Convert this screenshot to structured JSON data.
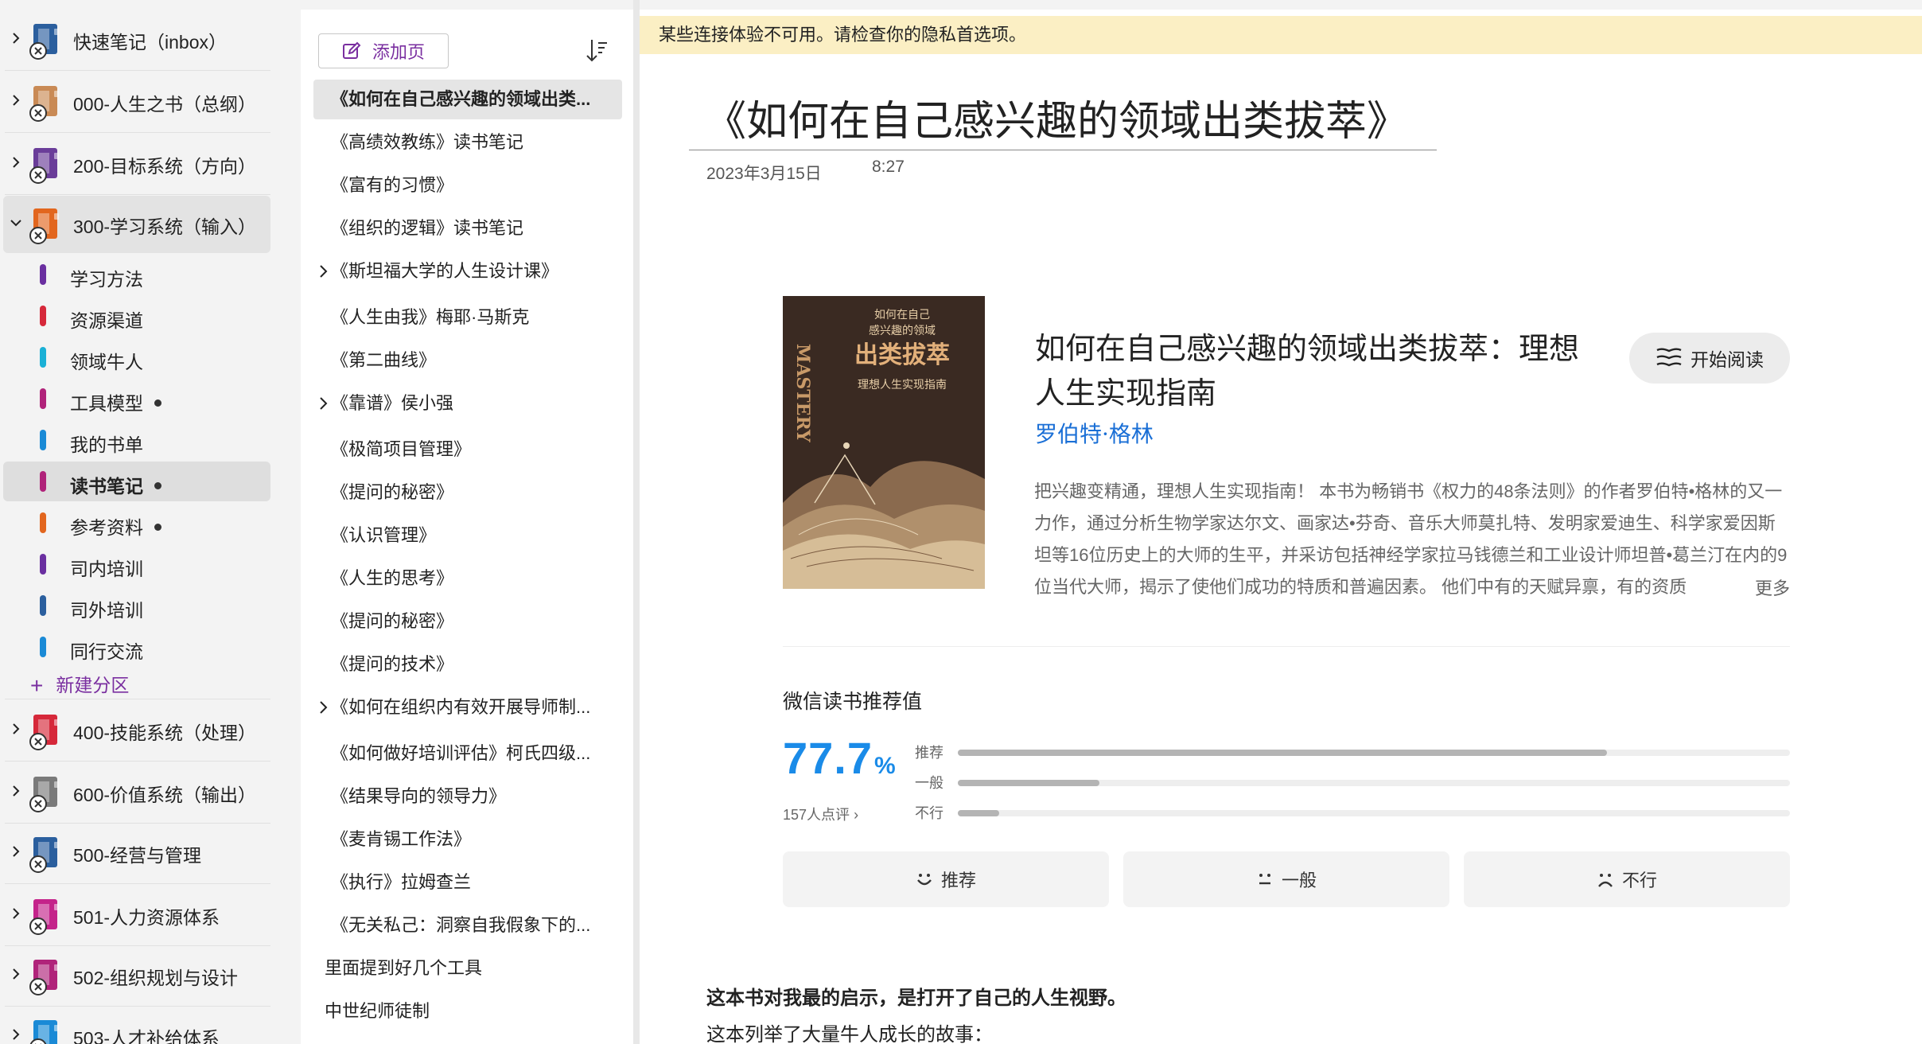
{
  "notebooks": [
    {
      "label": "快速笔记（inbox）",
      "color": "#2b5f9e",
      "expanded": false
    },
    {
      "label": "000-人生之书（总纲）",
      "color": "#c98a55",
      "expanded": false
    },
    {
      "label": "200-目标系统（方向）",
      "color": "#6a3d99",
      "expanded": false
    },
    {
      "label": "300-学习系统（输入）",
      "color": "#e2661e",
      "expanded": true
    },
    {
      "label": "400-技能系统（处理）",
      "color": "#d6283a",
      "expanded": false
    },
    {
      "label": "600-价值系统（输出）",
      "color": "#7a7a7a",
      "expanded": false
    },
    {
      "label": "500-经营与管理",
      "color": "#2b5f9e",
      "expanded": false
    },
    {
      "label": "501-人力资源体系",
      "color": "#c4238a",
      "expanded": false
    },
    {
      "label": "502-组织规划与设计",
      "color": "#b0237a",
      "expanded": false
    },
    {
      "label": "503-人才补给体系",
      "color": "#1a8ad6",
      "expanded": false
    }
  ],
  "sections": [
    {
      "label": "学习方法",
      "color": "#6a2fa0",
      "dot": false
    },
    {
      "label": "资源渠道",
      "color": "#d6283a",
      "dot": false
    },
    {
      "label": "领域牛人",
      "color": "#1ab0d6",
      "dot": false
    },
    {
      "label": "工具模型",
      "color": "#b0237a",
      "dot": true
    },
    {
      "label": "我的书单",
      "color": "#1a8ad6",
      "dot": false
    },
    {
      "label": "读书笔记",
      "color": "#b0237a",
      "dot": true
    },
    {
      "label": "参考资料",
      "color": "#e2661e",
      "dot": true
    },
    {
      "label": "司内培训",
      "color": "#6a2fa0",
      "dot": false
    },
    {
      "label": "司外培训",
      "color": "#2b5f9e",
      "dot": false
    },
    {
      "label": "同行交流",
      "color": "#1a8ad6",
      "dot": false
    }
  ],
  "new_section_label": "新建分区",
  "add_page_label": "添加页",
  "pages": [
    {
      "label": "《如何在自己感兴趣的领域出类...",
      "chev": false,
      "indent": false
    },
    {
      "label": "《高绩效教练》读书笔记",
      "chev": false,
      "indent": false
    },
    {
      "label": "《富有的习惯》",
      "chev": false,
      "indent": false
    },
    {
      "label": "《组织的逻辑》读书笔记",
      "chev": false,
      "indent": false
    },
    {
      "label": "《斯坦福大学的人生设计课》",
      "chev": true,
      "indent": false
    },
    {
      "label": "《人生由我》梅耶·马斯克",
      "chev": false,
      "indent": false
    },
    {
      "label": "《第二曲线》",
      "chev": false,
      "indent": false
    },
    {
      "label": "《靠谱》侯小强",
      "chev": true,
      "indent": false
    },
    {
      "label": "《极简项目管理》",
      "chev": false,
      "indent": false
    },
    {
      "label": "《提问的秘密》",
      "chev": false,
      "indent": false
    },
    {
      "label": "《认识管理》",
      "chev": false,
      "indent": false
    },
    {
      "label": "《人生的思考》",
      "chev": false,
      "indent": false
    },
    {
      "label": "《提问的秘密》",
      "chev": false,
      "indent": false
    },
    {
      "label": "《提问的技术》",
      "chev": false,
      "indent": false
    },
    {
      "label": "《如何在组织内有效开展导师制...",
      "chev": true,
      "indent": false
    },
    {
      "label": "《如何做好培训评估》柯氏四级...",
      "chev": false,
      "indent": false
    },
    {
      "label": "《结果导向的领导力》",
      "chev": false,
      "indent": false
    },
    {
      "label": "《麦肯锡工作法》",
      "chev": false,
      "indent": false
    },
    {
      "label": "《执行》拉姆查兰",
      "chev": false,
      "indent": false
    },
    {
      "label": "《无关私己：洞察自我假象下的...",
      "chev": false,
      "indent": false
    },
    {
      "label": "里面提到好几个工具",
      "chev": false,
      "indent": true
    },
    {
      "label": "中世纪师徒制",
      "chev": false,
      "indent": true
    }
  ],
  "banner": "某些连接体验不可用。请检查你的隐私首选项。",
  "page": {
    "title": "《如何在自己感兴趣的领域出类拔萃》",
    "date": "2023年3月15日",
    "time": "8:27"
  },
  "book": {
    "title": "如何在自己感兴趣的领域出类拔萃：理想人生实现指南",
    "author": "罗伯特·格林",
    "start_read": "开始阅读",
    "description": "把兴趣变精通，理想人生实现指南！ 本书为畅销书《权力的48条法则》的作者罗伯特•格林的又一力作，通过分析生物学家达尔文、画家达•芬奇、音乐大师莫扎特、发明家爱迪生、科学家爱因斯坦等16位历史上的大师的生平，并采访包括神经学家拉马钱德兰和工业设计师坦普•葛兰汀在内的9位当代大师，揭示了使他们成功的特质和普遍因素。 他们中有的天赋异禀，有的资质",
    "more": "更多",
    "cover": {
      "vertical": "MASTERY",
      "line1": "如何在自己",
      "line2": "感兴趣的领域",
      "big": "出类拔萃",
      "sub": "理想人生实现指南"
    }
  },
  "rating": {
    "heading": "微信读书推荐值",
    "value": "77.7",
    "unit": "%",
    "count": "157人点评",
    "bars": [
      {
        "label": "推荐",
        "fraction": 0.78
      },
      {
        "label": "一般",
        "fraction": 0.17
      },
      {
        "label": "不行",
        "fraction": 0.05
      }
    ],
    "buttons": [
      "推荐",
      "一般",
      "不行"
    ]
  },
  "notes": {
    "bold": "这本书对我最的启示，是打开了自己的人生视野。",
    "line": "这本列举了大量牛人成长的故事："
  },
  "colors": {
    "accent": "#7a2fa0",
    "link": "#1a6fd6",
    "rating": "#1a8be8",
    "banner": "#fbefc4"
  }
}
